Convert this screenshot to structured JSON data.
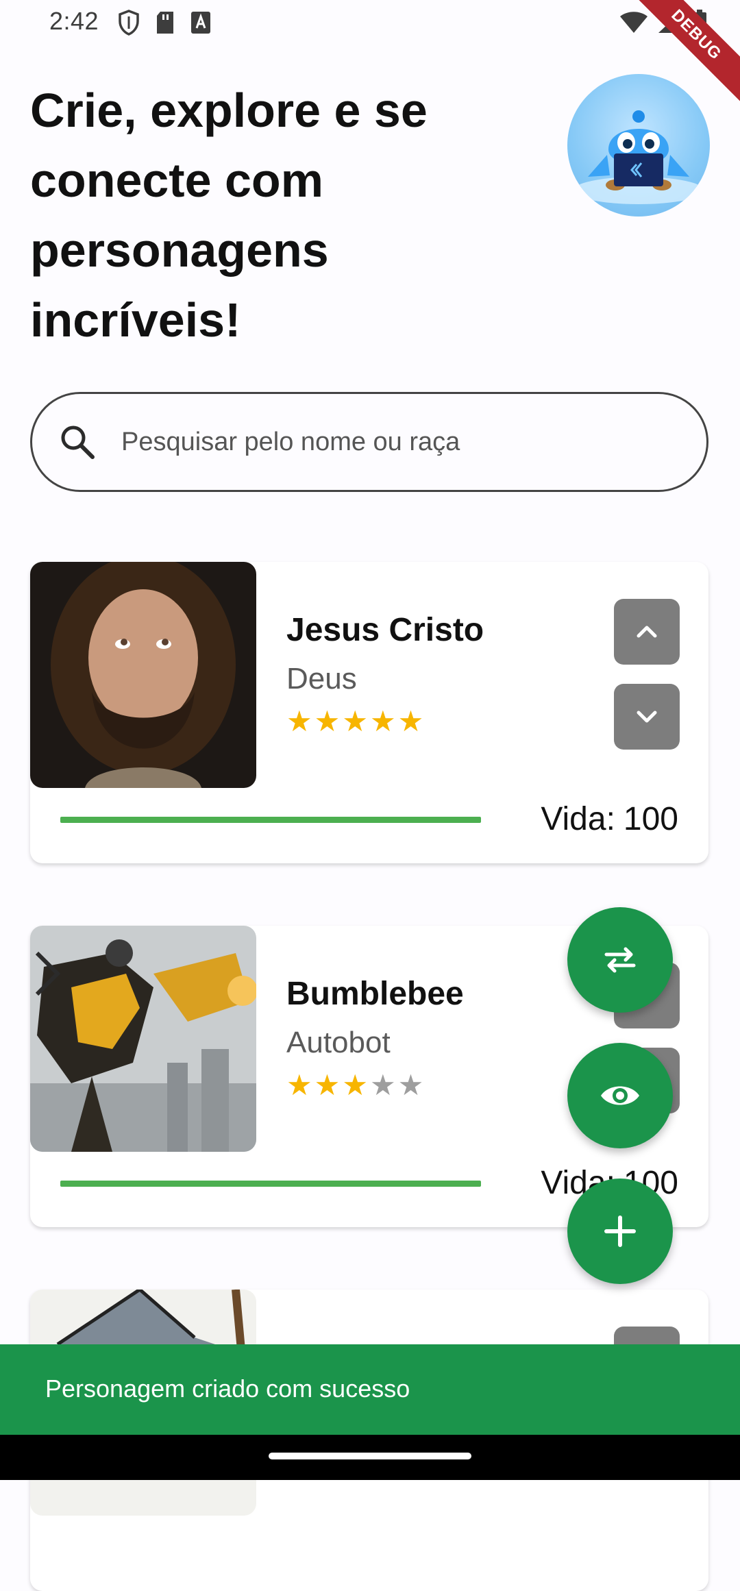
{
  "status_bar": {
    "time": "2:42",
    "icons": [
      "shield-icon",
      "sd-card-icon",
      "font-icon",
      "wifi-icon",
      "signal-icon",
      "battery-icon"
    ],
    "debug_label": "DEBUG"
  },
  "header": {
    "title": "Crie, explore e se conecte com personagens incríveis!"
  },
  "search": {
    "placeholder": "Pesquisar pelo nome ou raça",
    "value": ""
  },
  "characters": [
    {
      "name": "Jesus Cristo",
      "race": "Deus",
      "rating": 5,
      "max_rating": 5,
      "life_label": "Vida:",
      "life": "100",
      "life_fraction": 1.0
    },
    {
      "name": "Bumblebee",
      "race": "Autobot",
      "rating": 3,
      "max_rating": 5,
      "life_label": "Vida:",
      "life": "100",
      "life_fraction": 1.0
    }
  ],
  "fabs": [
    "swap-icon",
    "eye-icon",
    "add-icon"
  ],
  "snackbar": {
    "message": "Personagem criado com sucesso"
  },
  "colors": {
    "accent": "#1b944b",
    "progress": "#4caf50",
    "star": "#f7b500",
    "button_gray": "#7d7d7d"
  }
}
